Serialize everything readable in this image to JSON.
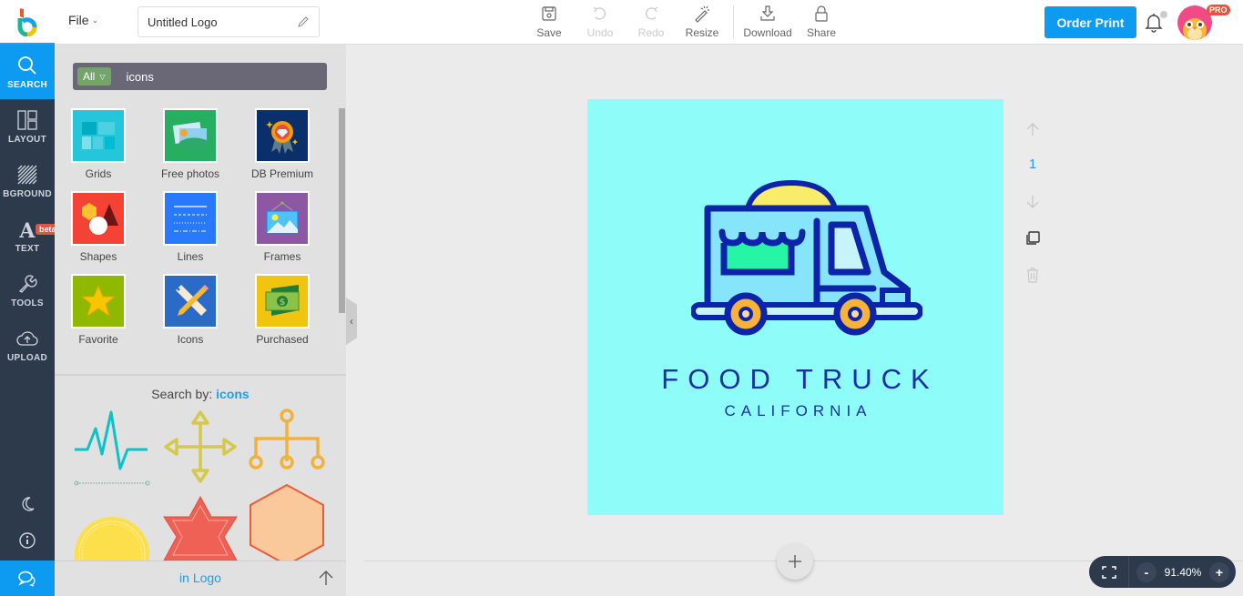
{
  "header": {
    "file_menu": "File",
    "title_value": "Untitled Logo",
    "toolbar": [
      {
        "label": "Save",
        "icon": "save-icon",
        "enabled": true
      },
      {
        "label": "Undo",
        "icon": "undo-icon",
        "enabled": false
      },
      {
        "label": "Redo",
        "icon": "redo-icon",
        "enabled": false
      },
      {
        "label": "Resize",
        "icon": "magic-wand-icon",
        "enabled": true
      },
      {
        "label": "Download",
        "icon": "download-icon",
        "enabled": true
      },
      {
        "label": "Share",
        "icon": "lock-icon",
        "enabled": true
      }
    ],
    "order_print": "Order Print",
    "pro_badge": "PRO"
  },
  "sidebar": {
    "items": [
      {
        "label": "SEARCH",
        "icon": "search-icon",
        "active": true
      },
      {
        "label": "LAYOUT",
        "icon": "layout-icon"
      },
      {
        "label": "BGROUND",
        "icon": "background-icon"
      },
      {
        "label": "TEXT",
        "icon": "text-icon"
      },
      {
        "label": "TOOLS",
        "icon": "wrench-icon"
      },
      {
        "label": "UPLOAD",
        "icon": "cloud-upload-icon"
      }
    ],
    "beta_badge": "beta",
    "bottom_icons": [
      "moon-icon",
      "info-icon",
      "chat-icon"
    ]
  },
  "panel": {
    "filter": "All",
    "search_value": "icons",
    "categories": [
      {
        "label": "Grids",
        "color": "#26c6da"
      },
      {
        "label": "Free photos",
        "color": "#27ae60"
      },
      {
        "label": "DB Premium",
        "color": "#0b2f6b"
      },
      {
        "label": "Shapes",
        "color": "#f44336"
      },
      {
        "label": "Lines",
        "color": "#2979ff"
      },
      {
        "label": "Frames",
        "color": "#8e57a3"
      },
      {
        "label": "Favorite",
        "color": "#8fb800"
      },
      {
        "label": "Icons",
        "color": "#2a6bc7"
      },
      {
        "label": "Purchased",
        "color": "#f1c40f"
      }
    ],
    "search_by_prefix": "Search by:",
    "search_by_term": "icons",
    "footer_link": "in Logo"
  },
  "canvas": {
    "background": "#8efcf8",
    "title": "FOOD TRUCK",
    "subtitle": "CALIFORNIA",
    "page_number": "1"
  },
  "zoom": {
    "minus": "-",
    "value": "91.40%",
    "plus": "+"
  }
}
